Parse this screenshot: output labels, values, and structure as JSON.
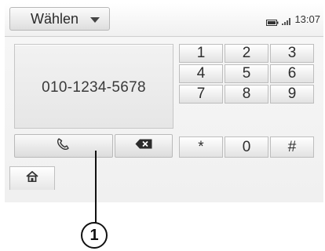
{
  "topbar": {
    "mode_label": "Wählen",
    "time": "13:07",
    "icons": [
      "battery-icon",
      "signal-icon",
      "chevron-down-icon"
    ]
  },
  "dialer": {
    "number": "010-1234-5678",
    "call_button_icon": "phone-icon",
    "delete_button_icon": "backspace-icon"
  },
  "keypad": {
    "keys": [
      "1",
      "2",
      "3",
      "4",
      "5",
      "6",
      "7",
      "8",
      "9",
      "*",
      "0",
      "#"
    ]
  },
  "nav": {
    "home_icon": "home-icon"
  },
  "callout": {
    "number": "1"
  }
}
